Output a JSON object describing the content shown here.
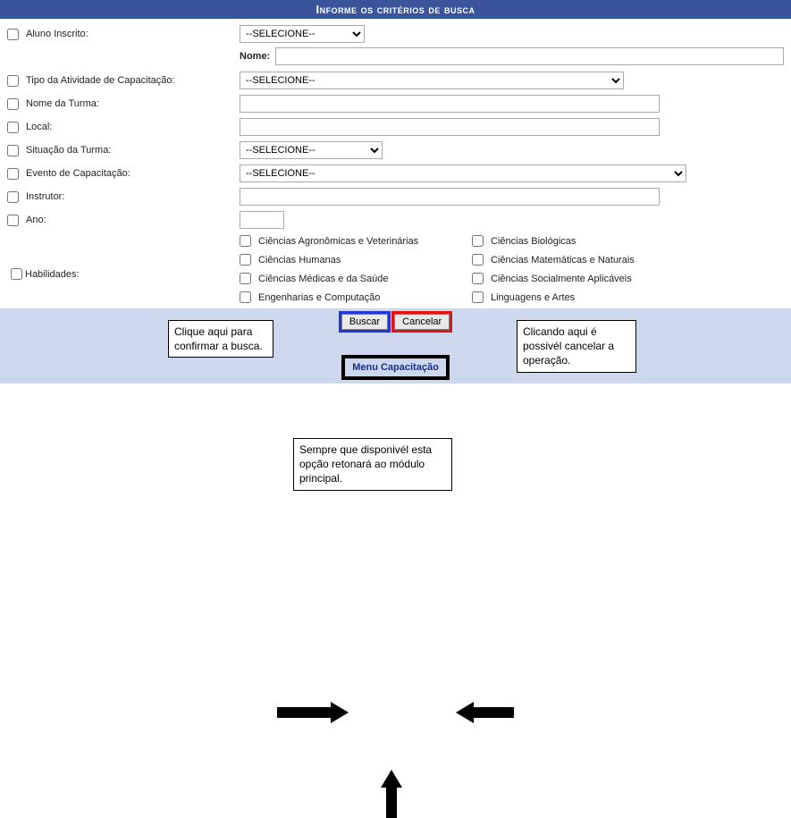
{
  "header": {
    "title": "Informe os critérios de busca"
  },
  "fields": {
    "aluno_inscrito": {
      "label": "Aluno Inscrito:",
      "select": "--SELECIONE--"
    },
    "nome": {
      "label": "Nome:",
      "value": ""
    },
    "tipo_atividade": {
      "label": "Tipo da Atividade de Capacitação:",
      "select": "--SELECIONE--"
    },
    "nome_turma": {
      "label": "Nome da Turma:",
      "value": ""
    },
    "local": {
      "label": "Local:",
      "value": ""
    },
    "situacao": {
      "label": "Situação da Turma:",
      "select": "--SELECIONE--"
    },
    "evento": {
      "label": "Evento de Capacitação:",
      "select": "--SELECIONE--"
    },
    "instrutor": {
      "label": "Instrutor:",
      "value": ""
    },
    "ano": {
      "label": "Ano:",
      "value": ""
    }
  },
  "skills": {
    "label": "Habilidades:",
    "items": [
      "Ciências Agronômicas e Veterinárias",
      "Ciências Biológicas",
      "Ciências Humanas",
      "Ciências Matemáticas e Naturais",
      "Ciências Médicas e da Saúde",
      "Ciências Socialmente Aplicáveis",
      "Engenharias e Computação",
      "Linguagens e Artes"
    ]
  },
  "buttons": {
    "search": "Buscar",
    "cancel": "Cancelar",
    "menu": "Menu Capacitação"
  },
  "callouts": {
    "left": "Clique aqui para confirmar a busca.",
    "right": "Clicando aqui é possivél cancelar a operação.",
    "bottom": "Sempre que disponivél esta opção retonará ao módulo principal."
  }
}
